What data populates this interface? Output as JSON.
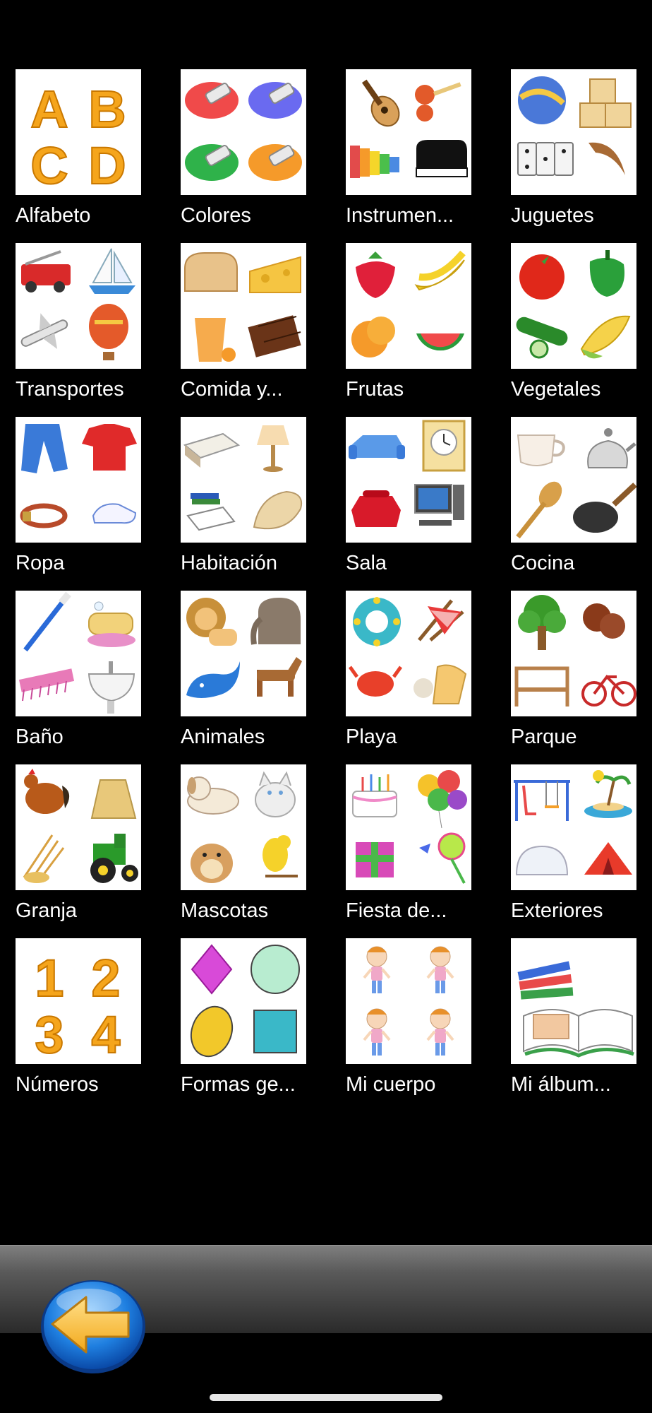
{
  "categories": [
    {
      "label": "Alfabeto",
      "icon": "alphabet-icon"
    },
    {
      "label": "Colores",
      "icon": "paint-colors-icon"
    },
    {
      "label": "Instrumen...",
      "icon": "musical-instruments-icon"
    },
    {
      "label": "Juguetes",
      "icon": "toys-icon"
    },
    {
      "label": "Transportes",
      "icon": "transport-icon"
    },
    {
      "label": "Comida y...",
      "icon": "food-icon"
    },
    {
      "label": "Frutas",
      "icon": "fruits-icon"
    },
    {
      "label": "Vegetales",
      "icon": "vegetables-icon"
    },
    {
      "label": "Ropa",
      "icon": "clothes-icon"
    },
    {
      "label": "Habitación",
      "icon": "bedroom-icon"
    },
    {
      "label": "Sala",
      "icon": "living-room-icon"
    },
    {
      "label": "Cocina",
      "icon": "kitchen-icon"
    },
    {
      "label": "Baño",
      "icon": "bathroom-icon"
    },
    {
      "label": "Animales",
      "icon": "animals-icon"
    },
    {
      "label": "Playa",
      "icon": "beach-icon"
    },
    {
      "label": "Parque",
      "icon": "park-icon"
    },
    {
      "label": "Granja",
      "icon": "farm-icon"
    },
    {
      "label": "Mascotas",
      "icon": "pets-icon"
    },
    {
      "label": "Fiesta de...",
      "icon": "party-icon"
    },
    {
      "label": "Exteriores",
      "icon": "outdoors-icon"
    },
    {
      "label": "Números",
      "icon": "numbers-icon"
    },
    {
      "label": "Formas ge...",
      "icon": "shapes-icon"
    },
    {
      "label": "Mi cuerpo",
      "icon": "my-body-icon"
    },
    {
      "label": "Mi álbum...",
      "icon": "photo-album-icon"
    }
  ],
  "alphabet_letters": [
    "A",
    "B",
    "C",
    "D"
  ],
  "number_digits": [
    "1",
    "2",
    "3",
    "4"
  ],
  "colors": {
    "background": "#000000",
    "tile": "#ffffff",
    "label_text": "#ffffff",
    "accent_orange": "#f5a51c",
    "back_button_blue": "#1f7fe0",
    "back_arrow_yellow": "#f7c23a"
  },
  "back_button": {
    "icon": "back-arrow-icon"
  }
}
